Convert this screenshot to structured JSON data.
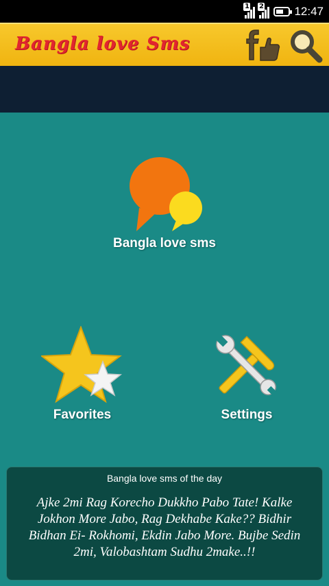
{
  "status": {
    "sim1": "1",
    "sim2": "2",
    "time": "12:47",
    "battery_level": 0.6
  },
  "appbar": {
    "title": "Bangla love Sms",
    "facebook_icon": "facebook-like-icon",
    "search_icon": "search-icon"
  },
  "tiles": {
    "sms_label": "Bangla love sms",
    "favorites_label": "Favorites",
    "settings_label": "Settings"
  },
  "sms_of_day": {
    "heading": "Bangla love sms of the day",
    "text": "Ajke 2mi Rag Korecho Dukkho Pabo Tate! Kalke Jokhon More Jabo, Rag Dekhabe Kake?? Bidhir Bidhan Ei- Rokhomi, Ekdin Jabo More. Bujbe Sedin 2mi, Valobashtam Sudhu 2make..!!"
  },
  "colors": {
    "background": "#1a8a86",
    "appbar": "#f2bb18",
    "title": "#e2252f",
    "band": "#0e1f33"
  }
}
